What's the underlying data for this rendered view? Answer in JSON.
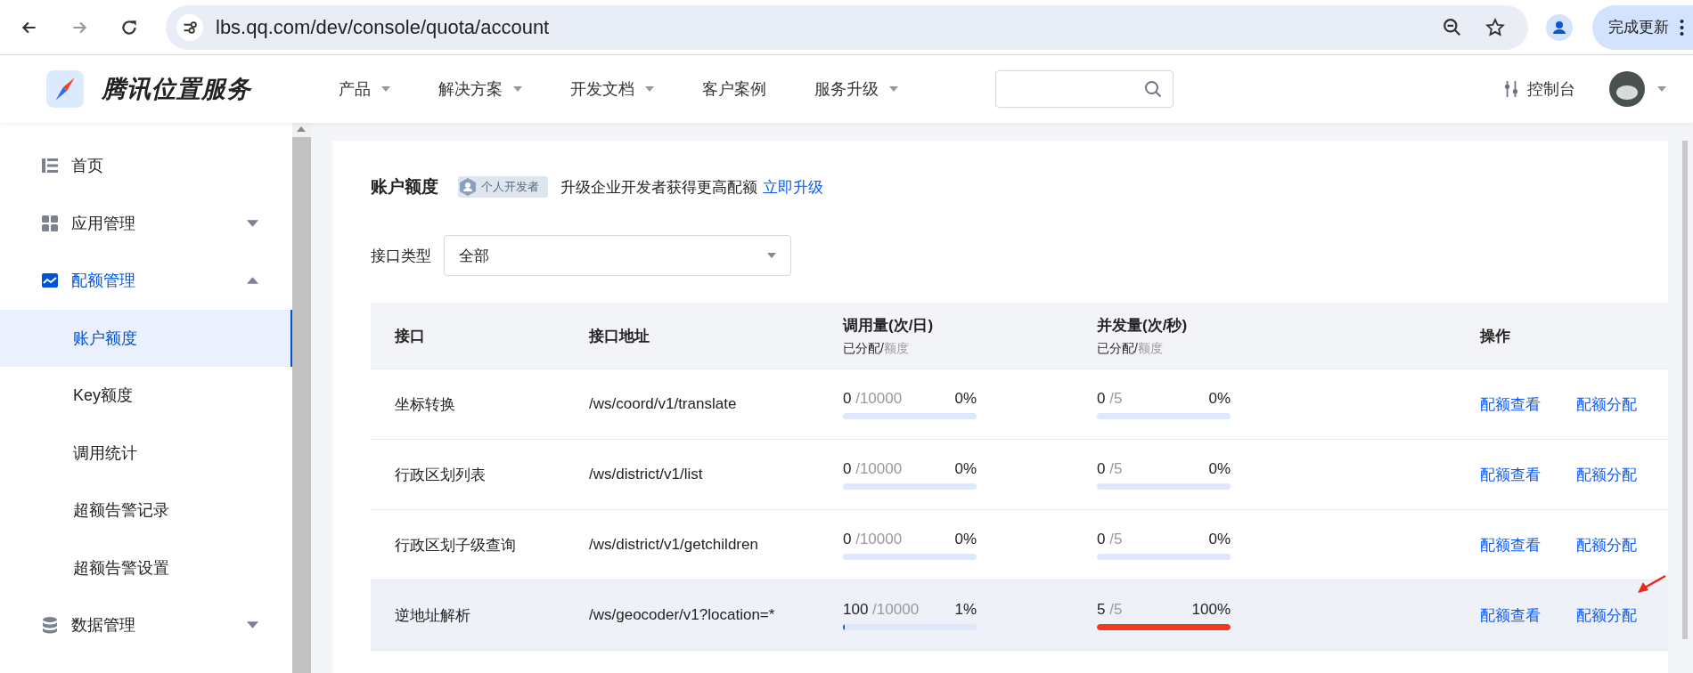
{
  "browser": {
    "url": "lbs.qq.com/dev/console/quota/account",
    "update_button": "完成更新"
  },
  "header": {
    "brand": "腾讯位置服务",
    "nav": [
      {
        "label": "产品",
        "dropdown": true
      },
      {
        "label": "解决方案",
        "dropdown": true
      },
      {
        "label": "开发文档",
        "dropdown": true
      },
      {
        "label": "客户案例",
        "dropdown": false
      },
      {
        "label": "服务升级",
        "dropdown": true
      }
    ],
    "console": "控制台"
  },
  "sidebar": {
    "items": [
      {
        "label": "首页",
        "selected": false
      },
      {
        "label": "应用管理",
        "selected": false,
        "expanded": false
      },
      {
        "label": "配额管理",
        "selected": true,
        "expanded": true,
        "children": [
          {
            "label": "账户额度",
            "selected": true
          },
          {
            "label": "Key额度",
            "selected": false
          },
          {
            "label": "调用统计",
            "selected": false
          },
          {
            "label": "超额告警记录",
            "selected": false
          },
          {
            "label": "超额告警设置",
            "selected": false
          }
        ]
      },
      {
        "label": "数据管理",
        "selected": false,
        "expanded": false
      }
    ]
  },
  "page": {
    "title": "账户额度",
    "badge": "个人开发者",
    "notice": "升级企业开发者获得更高配额",
    "upgrade_link": "立即升级",
    "filter": {
      "label": "接口类型",
      "value": "全部"
    }
  },
  "table": {
    "columns": [
      {
        "title": "接口"
      },
      {
        "title": "接口地址"
      },
      {
        "title": "调用量(次/日)",
        "sub_a": "已分配/",
        "sub_b": "额度"
      },
      {
        "title": "并发量(次/秒)",
        "sub_a": "已分配/",
        "sub_b": "额度"
      },
      {
        "title": "操作"
      }
    ],
    "rows": [
      {
        "name": "坐标转换",
        "path": "/ws/coord/v1/translate",
        "calls": {
          "used": "0",
          "quota": "/10000",
          "percent": "0%",
          "level": 0
        },
        "concurrency": {
          "used": "0",
          "quota": "/5",
          "percent": "0%",
          "level": 0
        },
        "actions": [
          "配额查看",
          "配额分配"
        ],
        "highlighted": false,
        "marked": false
      },
      {
        "name": "行政区划列表",
        "path": "/ws/district/v1/list",
        "calls": {
          "used": "0",
          "quota": "/10000",
          "percent": "0%",
          "level": 0
        },
        "concurrency": {
          "used": "0",
          "quota": "/5",
          "percent": "0%",
          "level": 0
        },
        "actions": [
          "配额查看",
          "配额分配"
        ],
        "highlighted": false,
        "marked": false
      },
      {
        "name": "行政区划子级查询",
        "path": "/ws/district/v1/getchildren",
        "calls": {
          "used": "0",
          "quota": "/10000",
          "percent": "0%",
          "level": 0
        },
        "concurrency": {
          "used": "0",
          "quota": "/5",
          "percent": "0%",
          "level": 0
        },
        "actions": [
          "配额查看",
          "配额分配"
        ],
        "highlighted": false,
        "marked": false
      },
      {
        "name": "逆地址解析",
        "path": "/ws/geocoder/v1?location=*",
        "calls": {
          "used": "100",
          "quota": "/10000",
          "percent": "1%",
          "level": 0.01
        },
        "concurrency": {
          "used": "5",
          "quota": "/5",
          "percent": "100%",
          "level": 1
        },
        "actions": [
          "配额查看",
          "配额分配"
        ],
        "highlighted": true,
        "marked": true
      }
    ]
  }
}
